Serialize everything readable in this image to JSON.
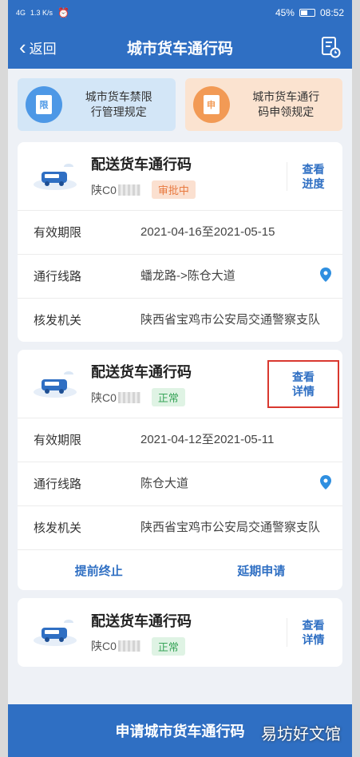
{
  "status_bar": {
    "signal": "4G",
    "speed": "1.3 K/s",
    "battery": "45%",
    "time": "08:52"
  },
  "nav": {
    "back_label": "返回",
    "title": "城市货车通行码",
    "right_icon": "document-clock-icon"
  },
  "rules": [
    {
      "label": "城市货车禁限行管理规定",
      "line1": "城市货车禁限",
      "line2": "行管理规定",
      "icon_char": "限",
      "color": "#4d98e6"
    },
    {
      "label": "城市货车通行码申领规定",
      "line1": "城市货车通行",
      "line2": "码申领规定",
      "icon_char": "申",
      "color": "#f29a55"
    }
  ],
  "cards": [
    {
      "title": "配送货车通行码",
      "plate": "陕C0",
      "status": "审批中",
      "link_line1": "查看",
      "link_line2": "进度",
      "valid_label": "有效期限",
      "valid_value": "2021-04-16至2021-05-15",
      "route_label": "通行线路",
      "route_value": "蟠龙路->陈仓大道",
      "issuer_label": "核发机关",
      "issuer_value": "陕西省宝鸡市公安局交通警察支队"
    },
    {
      "title": "配送货车通行码",
      "plate": "陕C0",
      "status": "正常",
      "link_line1": "查看",
      "link_line2": "详情",
      "valid_label": "有效期限",
      "valid_value": "2021-04-12至2021-05-11",
      "route_label": "通行线路",
      "route_value": "陈仓大道",
      "issuer_label": "核发机关",
      "issuer_value": "陕西省宝鸡市公安局交通警察支队",
      "action_stop": "提前终止",
      "action_extend": "延期申请"
    },
    {
      "title": "配送货车通行码",
      "plate": "陕C0",
      "status": "正常",
      "link_line1": "查看",
      "link_line2": "详情"
    }
  ],
  "bottom": {
    "label": "申请城市货车通行码",
    "watermark": "易坊好文馆"
  },
  "colors": {
    "primary": "#2f6fc3",
    "pending": "#e8793f",
    "normal": "#3aa55a",
    "highlight_box": "#d9382f"
  }
}
